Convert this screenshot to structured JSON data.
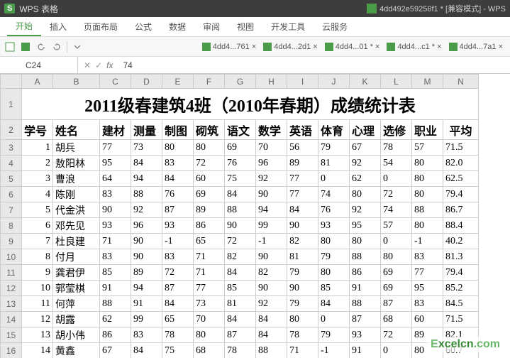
{
  "titlebar": {
    "appname": "WPS 表格",
    "docname": "4dd492e59256f1 * [兼容模式] - WPS"
  },
  "menutabs": [
    "开始",
    "插入",
    "页面布局",
    "公式",
    "数据",
    "审阅",
    "视图",
    "开发工具",
    "云服务"
  ],
  "filetabs": [
    "4dd4...761 ×",
    "4dd4...2d1 ×",
    "4dd4...01 * ×",
    "4dd4...c1 * ×",
    "4dd4...7a1 ×"
  ],
  "formulabar": {
    "cellref": "C24",
    "value": "74"
  },
  "columns": [
    "A",
    "B",
    "C",
    "D",
    "E",
    "F",
    "G",
    "H",
    "I",
    "J",
    "K",
    "L",
    "M",
    "N"
  ],
  "titlecell": "2011级春建筑4班（2010年春期）成绩统计表",
  "headerrow": [
    "学号",
    "姓名",
    "建材",
    "测量",
    "制图",
    "砌筑",
    "语文",
    "数学",
    "英语",
    "体育",
    "心理",
    "选修",
    "职业",
    "平均"
  ],
  "rows": [
    [
      "1",
      "胡兵",
      "77",
      "73",
      "80",
      "80",
      "69",
      "70",
      "56",
      "79",
      "67",
      "78",
      "57",
      "71.5"
    ],
    [
      "2",
      "敖阳林",
      "95",
      "84",
      "83",
      "72",
      "76",
      "96",
      "89",
      "81",
      "92",
      "54",
      "80",
      "82.0"
    ],
    [
      "3",
      "曹浪",
      "64",
      "94",
      "84",
      "60",
      "75",
      "92",
      "77",
      "0",
      "62",
      "0",
      "80",
      "62.5"
    ],
    [
      "4",
      "陈刚",
      "83",
      "88",
      "76",
      "69",
      "84",
      "90",
      "77",
      "74",
      "80",
      "72",
      "80",
      "79.4"
    ],
    [
      "5",
      "代金洪",
      "90",
      "92",
      "87",
      "89",
      "88",
      "94",
      "84",
      "76",
      "92",
      "74",
      "88",
      "86.7"
    ],
    [
      "6",
      "邓先见",
      "93",
      "96",
      "93",
      "86",
      "90",
      "99",
      "90",
      "93",
      "95",
      "57",
      "80",
      "88.4"
    ],
    [
      "7",
      "杜良建",
      "71",
      "90",
      "-1",
      "65",
      "72",
      "-1",
      "82",
      "80",
      "80",
      "0",
      "-1",
      "40.2"
    ],
    [
      "8",
      "付月",
      "83",
      "90",
      "83",
      "71",
      "82",
      "90",
      "81",
      "79",
      "88",
      "80",
      "83",
      "81.3"
    ],
    [
      "9",
      "龚君伊",
      "85",
      "89",
      "72",
      "71",
      "84",
      "82",
      "79",
      "80",
      "86",
      "69",
      "77",
      "79.4"
    ],
    [
      "10",
      "郭莹棋",
      "91",
      "94",
      "87",
      "77",
      "85",
      "90",
      "90",
      "85",
      "91",
      "69",
      "95",
      "85.2"
    ],
    [
      "11",
      "何萍",
      "88",
      "91",
      "84",
      "73",
      "81",
      "92",
      "79",
      "84",
      "88",
      "87",
      "83",
      "84.5"
    ],
    [
      "12",
      "胡露",
      "62",
      "99",
      "65",
      "70",
      "84",
      "84",
      "80",
      "0",
      "87",
      "68",
      "60",
      "71.5"
    ],
    [
      "13",
      "胡小伟",
      "86",
      "83",
      "78",
      "80",
      "87",
      "84",
      "78",
      "79",
      "93",
      "72",
      "89",
      "82.1"
    ],
    [
      "14",
      "黄鑫",
      "67",
      "84",
      "75",
      "68",
      "78",
      "88",
      "71",
      "-1",
      "91",
      "0",
      "80",
      "60.7"
    ]
  ],
  "watermark": {
    "a": "E",
    "b": "xcelcn",
    "c": ".com"
  }
}
